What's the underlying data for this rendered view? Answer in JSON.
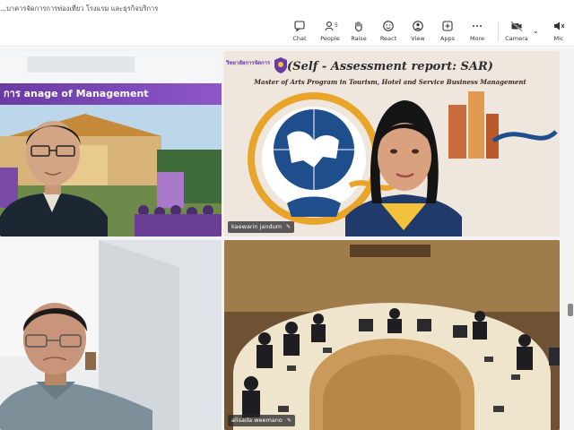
{
  "meeting": {
    "title": "...บาคารจัดการการท่องเที่ยว โรงแรม และธุรกิจบริการ"
  },
  "toolbar": {
    "chat": "Chat",
    "people": "People",
    "people_count": "5",
    "raise": "Raise",
    "react": "React",
    "view": "View",
    "apps": "Apps",
    "more": "More",
    "camera": "Camera",
    "mic": "Mic"
  },
  "tiles": {
    "t1": {
      "banner": "การ  anage of Management"
    },
    "t2": {
      "name": "kaewarin jandum",
      "logo_text": "วิทยาลัยการจัดการ",
      "slide_title": "(Self - Assessment report: SAR)",
      "slide_subtitle": "Master of Arts Program in Tourism, Hotel and Service Business Management"
    },
    "t3": {},
    "t4": {
      "name": "alisada weemano"
    }
  },
  "colors": {
    "accent_purple": "#7a45b8",
    "slide_blue": "#1f4e8c",
    "slide_gold": "#e8a52a"
  }
}
